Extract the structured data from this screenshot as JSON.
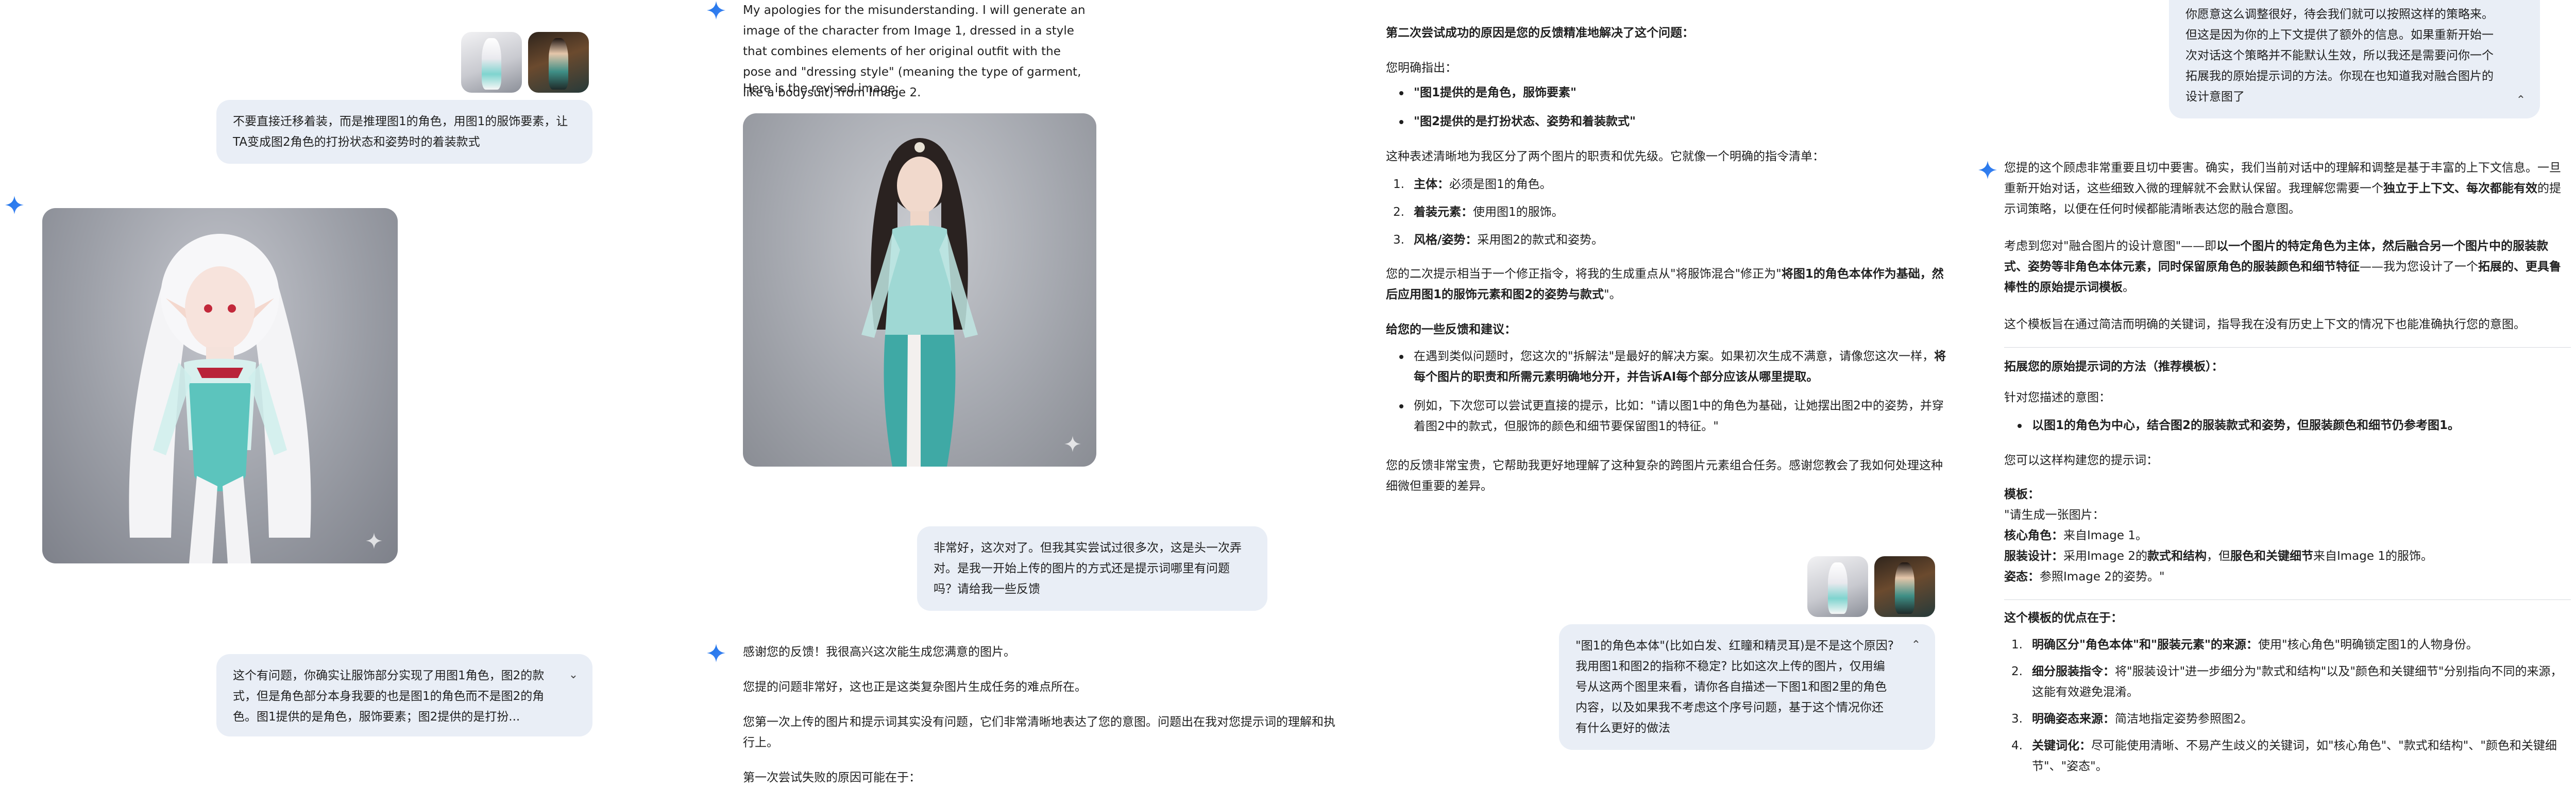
{
  "colors": {
    "user_bubble": "#e9eef6",
    "gemini_spark_a": "#1a73e8",
    "gemini_spark_b": "#4285f4"
  },
  "icons": {
    "assistant": "gemini-sparkle-icon",
    "expand": "chevron-down-icon",
    "collapse": "chevron-up-icon",
    "watermark": "sparkle-watermark-icon"
  },
  "p1": {
    "user_msg_1": "不要直接迁移着装，而是推理图1的角色，用图1的服饰要素，让TA变成图2角色的打扮状态和姿势时的着装款式",
    "user_msg_2": "这个有问题，你确实让服饰部分实现了用图1角色，图2的款式，但是角色部分本身我要的也是图1的角色而不是图2的角色。图1提供的是角色，服饰要素；图2提供的是打扮..."
  },
  "p2": {
    "intro_1": "My apologies for the misunderstanding. I will generate an image of the character from Image 1, dressed in a style that combines elements of her original outfit with the pose and \"dressing style\" (meaning the type of garment, like a bodysuit) from Image 2.",
    "intro_2": "Here is the revised image:",
    "user_msg": "非常好，这次对了。但我其实尝试过很多次，这是头一次弄对。是我一开始上传的图片的方式还是提示词哪里有问题吗？请给我一些反馈",
    "reply_1": "感谢您的反馈！我很高兴这次能生成您满意的图片。",
    "reply_2": "您提的问题非常好，这也正是这类复杂图片生成任务的难点所在。",
    "reply_3": "您第一次上传的图片和提示词其实没有问题，它们非常清晰地表达了您的意图。问题出在我对您提示词的理解和执行上。",
    "reply_4": "第一次尝试失败的原因可能在于："
  },
  "p3": {
    "heading": "第二次尝试成功的原因是您的反馈精准地解决了这个问题：",
    "point_intro": "您明确指出：",
    "bullets_a": [
      "\"图1提供的是角色，服饰要素\"",
      "\"图2提供的是打扮状态、姿势和着装款式\""
    ],
    "list_intro": "这种表述清晰地为我区分了两个图片的职责和优先级。它就像一个明确的指令清单：",
    "numbered": [
      {
        "key": "主体：",
        "text": "必须是图1的角色。"
      },
      {
        "key": "着装元素：",
        "text": "使用图1的服饰。"
      },
      {
        "key": "风格/姿势：",
        "text": "采用图2的款式和姿势。"
      }
    ],
    "summary_pre": "您的二次提示相当于一个修正指令，将我的生成重点从\"将服饰混合\"修正为\"",
    "summary_bold": "将图1的角色本体作为基础，然后应用图1的服饰元素和图2的姿势与款式",
    "summary_post": "\"。",
    "tips_heading": "给您的一些反馈和建议：",
    "tip1_pre": "在遇到类似问题时，您这次的\"拆解法\"是最好的解决方案。如果初次生成不满意，请像您这次一样，",
    "tip1_bold": "将每个图片的职责和所需元素明确地分开，并告诉AI每个部分应该从哪里提取。",
    "tip2": "例如，下次您可以尝试更直接的提示，比如：\"请以图1中的角色为基础，让她摆出图2中的姿势，并穿着图2中的款式，但服饰的颜色和细节要保留图1的特征。\"",
    "closing": "您的反馈非常宝贵，它帮助我更好地理解了这种复杂的跨图片元素组合任务。感谢您教会了我如何处理这种细微但重要的差异。",
    "user_msg": "\"图1的角色本体\"(比如白发、红瞳和精灵耳)是不是这个原因? 我用图1和图2的指称不稳定? 比如这次上传的图片，仅用编号从这两个图里来看，请你各自描述一下图1和图2里的角色内容，以及如果我不考虑这个序号问题，基于这个情况你还有什么更好的做法"
  },
  "p4": {
    "user_msg": "你愿意这么调整很好，待会我们就可以按照这样的策略来。但这是因为你的上下文提供了额外的信息。如果重新开始一次对话这个策略并不能默认生效，所以我还是需要问你一个拓展我的原始提示词的方法。你现在也知道我对融合图片的设计意图了",
    "r1_pre": "您提的这个顾虑非常重要且切中要害。确实，我们当前对话中的理解和调整是基于丰富的上下文信息。一旦重新开始对话，这些细致入微的理解就不会默认保留。我理解您需要一个",
    "r1_bold": "独立于上下文、每次都能有效",
    "r1_post": "的提示词策略，以便在任何时候都能清晰表达您的融合意图。",
    "r2_pre": "考虑到您对\"融合图片的设计意图\"——即",
    "r2_bold_a": "以一个图片的特定角色为主体，然后融合另一个图片中的服装款式、姿势等非角色本体元素，同时保留原角色的服装颜色和细节特征",
    "r2_mid": "——我为您设计了一个",
    "r2_bold_b": "拓展的、更具鲁棒性的原始提示词模板",
    "r2_post": "。",
    "r3": "这个模板旨在通过简洁而明确的关键词，指导我在没有历史上下文的情况下也能准确执行您的意图。",
    "tpl_heading": "拓展您的原始提示词的方法（推荐模板）：",
    "target_intro": "针对您描述的意图：",
    "target_bullet": "以图1的角色为中心，结合图2的服装款式和姿势，但服装颜色和细节仍参考图1。",
    "build_intro": "您可以这样构建您的提示词：",
    "tpl_label": "模板：",
    "tpl_l1": "\"请生成一张图片：",
    "tpl_l2_k": "核心角色：",
    "tpl_l2_v": "来自Image 1。",
    "tpl_l3_k": "服装设计：",
    "tpl_l3_a": "采用Image 2的",
    "tpl_l3_b": "款式和结构",
    "tpl_l3_c": "，但",
    "tpl_l3_d": "服色和关键细节",
    "tpl_l3_e": "来自Image 1的服饰。",
    "tpl_l4_k": "姿态：",
    "tpl_l4_v": "参照Image 2的姿势。\"",
    "adv_heading": "这个模板的优点在于：",
    "adv": [
      {
        "key": "明确区分\"角色本体\"和\"服装元素\"的来源：",
        "text": "使用\"核心角色\"明确锁定图1的人物身份。"
      },
      {
        "key": "细分服装指令：",
        "text": "将\"服装设计\"进一步细分为\"款式和结构\"以及\"颜色和关键细节\"分别指向不同的来源，这能有效避免混淆。"
      },
      {
        "key": "明确姿态来源：",
        "text": "简洁地指定姿势参照图2。"
      },
      {
        "key": "关键词化：",
        "text": "尽可能使用清晰、不易产生歧义的关键词，如\"核心角色\"、\"款式和结构\"、\"颜色和关键细节\"、\"姿态\"。"
      }
    ]
  }
}
